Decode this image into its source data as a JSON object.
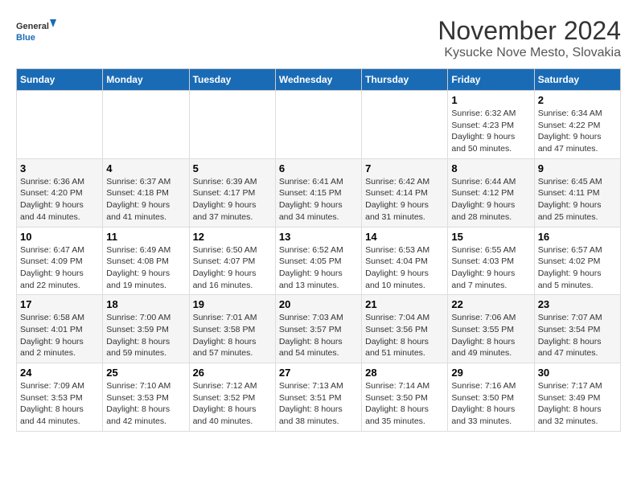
{
  "logo": {
    "line1": "General",
    "line2": "Blue"
  },
  "title": "November 2024",
  "location": "Kysucke Nove Mesto, Slovakia",
  "days_header": [
    "Sunday",
    "Monday",
    "Tuesday",
    "Wednesday",
    "Thursday",
    "Friday",
    "Saturday"
  ],
  "weeks": [
    [
      {
        "day": "",
        "info": ""
      },
      {
        "day": "",
        "info": ""
      },
      {
        "day": "",
        "info": ""
      },
      {
        "day": "",
        "info": ""
      },
      {
        "day": "",
        "info": ""
      },
      {
        "day": "1",
        "info": "Sunrise: 6:32 AM\nSunset: 4:23 PM\nDaylight: 9 hours\nand 50 minutes."
      },
      {
        "day": "2",
        "info": "Sunrise: 6:34 AM\nSunset: 4:22 PM\nDaylight: 9 hours\nand 47 minutes."
      }
    ],
    [
      {
        "day": "3",
        "info": "Sunrise: 6:36 AM\nSunset: 4:20 PM\nDaylight: 9 hours\nand 44 minutes."
      },
      {
        "day": "4",
        "info": "Sunrise: 6:37 AM\nSunset: 4:18 PM\nDaylight: 9 hours\nand 41 minutes."
      },
      {
        "day": "5",
        "info": "Sunrise: 6:39 AM\nSunset: 4:17 PM\nDaylight: 9 hours\nand 37 minutes."
      },
      {
        "day": "6",
        "info": "Sunrise: 6:41 AM\nSunset: 4:15 PM\nDaylight: 9 hours\nand 34 minutes."
      },
      {
        "day": "7",
        "info": "Sunrise: 6:42 AM\nSunset: 4:14 PM\nDaylight: 9 hours\nand 31 minutes."
      },
      {
        "day": "8",
        "info": "Sunrise: 6:44 AM\nSunset: 4:12 PM\nDaylight: 9 hours\nand 28 minutes."
      },
      {
        "day": "9",
        "info": "Sunrise: 6:45 AM\nSunset: 4:11 PM\nDaylight: 9 hours\nand 25 minutes."
      }
    ],
    [
      {
        "day": "10",
        "info": "Sunrise: 6:47 AM\nSunset: 4:09 PM\nDaylight: 9 hours\nand 22 minutes."
      },
      {
        "day": "11",
        "info": "Sunrise: 6:49 AM\nSunset: 4:08 PM\nDaylight: 9 hours\nand 19 minutes."
      },
      {
        "day": "12",
        "info": "Sunrise: 6:50 AM\nSunset: 4:07 PM\nDaylight: 9 hours\nand 16 minutes."
      },
      {
        "day": "13",
        "info": "Sunrise: 6:52 AM\nSunset: 4:05 PM\nDaylight: 9 hours\nand 13 minutes."
      },
      {
        "day": "14",
        "info": "Sunrise: 6:53 AM\nSunset: 4:04 PM\nDaylight: 9 hours\nand 10 minutes."
      },
      {
        "day": "15",
        "info": "Sunrise: 6:55 AM\nSunset: 4:03 PM\nDaylight: 9 hours\nand 7 minutes."
      },
      {
        "day": "16",
        "info": "Sunrise: 6:57 AM\nSunset: 4:02 PM\nDaylight: 9 hours\nand 5 minutes."
      }
    ],
    [
      {
        "day": "17",
        "info": "Sunrise: 6:58 AM\nSunset: 4:01 PM\nDaylight: 9 hours\nand 2 minutes."
      },
      {
        "day": "18",
        "info": "Sunrise: 7:00 AM\nSunset: 3:59 PM\nDaylight: 8 hours\nand 59 minutes."
      },
      {
        "day": "19",
        "info": "Sunrise: 7:01 AM\nSunset: 3:58 PM\nDaylight: 8 hours\nand 57 minutes."
      },
      {
        "day": "20",
        "info": "Sunrise: 7:03 AM\nSunset: 3:57 PM\nDaylight: 8 hours\nand 54 minutes."
      },
      {
        "day": "21",
        "info": "Sunrise: 7:04 AM\nSunset: 3:56 PM\nDaylight: 8 hours\nand 51 minutes."
      },
      {
        "day": "22",
        "info": "Sunrise: 7:06 AM\nSunset: 3:55 PM\nDaylight: 8 hours\nand 49 minutes."
      },
      {
        "day": "23",
        "info": "Sunrise: 7:07 AM\nSunset: 3:54 PM\nDaylight: 8 hours\nand 47 minutes."
      }
    ],
    [
      {
        "day": "24",
        "info": "Sunrise: 7:09 AM\nSunset: 3:53 PM\nDaylight: 8 hours\nand 44 minutes."
      },
      {
        "day": "25",
        "info": "Sunrise: 7:10 AM\nSunset: 3:53 PM\nDaylight: 8 hours\nand 42 minutes."
      },
      {
        "day": "26",
        "info": "Sunrise: 7:12 AM\nSunset: 3:52 PM\nDaylight: 8 hours\nand 40 minutes."
      },
      {
        "day": "27",
        "info": "Sunrise: 7:13 AM\nSunset: 3:51 PM\nDaylight: 8 hours\nand 38 minutes."
      },
      {
        "day": "28",
        "info": "Sunrise: 7:14 AM\nSunset: 3:50 PM\nDaylight: 8 hours\nand 35 minutes."
      },
      {
        "day": "29",
        "info": "Sunrise: 7:16 AM\nSunset: 3:50 PM\nDaylight: 8 hours\nand 33 minutes."
      },
      {
        "day": "30",
        "info": "Sunrise: 7:17 AM\nSunset: 3:49 PM\nDaylight: 8 hours\nand 32 minutes."
      }
    ]
  ]
}
